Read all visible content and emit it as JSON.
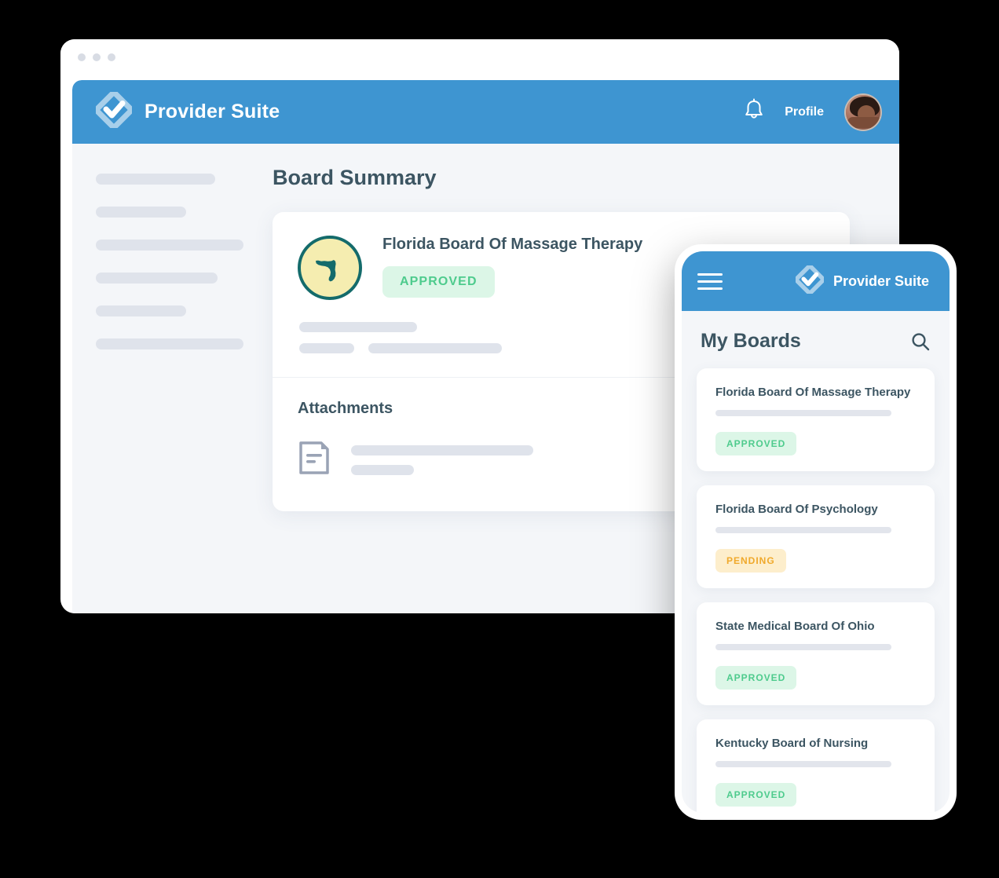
{
  "window": {
    "chrome_dots": [
      "dot-1",
      "dot-2",
      "dot-3"
    ]
  },
  "desktop": {
    "topbar": {
      "logo_icon": "diamond-check-logo-icon",
      "brand": "Provider Suite",
      "notification_icon": "bell-icon",
      "profile_label": "Profile",
      "avatar_icon": "user-avatar"
    },
    "sidebar": {
      "placeholder_widths": [
        152,
        115,
        188,
        155,
        115,
        188
      ]
    },
    "main": {
      "page_title": "Board Summary",
      "card": {
        "seal_icon": "florida-state-seal-icon",
        "board_name": "Florida Board Of Massage Therapy",
        "status": "APPROVED",
        "placeholder_rows": [
          [
            150
          ],
          [
            70,
            170
          ]
        ],
        "attachments_title": "Attachments",
        "attachment_icon": "document-icon",
        "attachment_placeholder_widths": [
          232,
          80
        ]
      }
    }
  },
  "phone": {
    "topbar": {
      "menu_icon": "hamburger-menu-icon",
      "logo_icon": "diamond-check-logo-icon",
      "brand": "Provider Suite"
    },
    "header": {
      "title": "My Boards",
      "search_icon": "search-icon"
    },
    "boards": [
      {
        "name": "Florida Board Of Massage Therapy",
        "status": "APPROVED",
        "status_type": "approved"
      },
      {
        "name": "Florida Board Of Psychology",
        "status": "PENDING",
        "status_type": "pending"
      },
      {
        "name": "State Medical Board Of Ohio",
        "status": "APPROVED",
        "status_type": "approved"
      },
      {
        "name": "Kentucky Board of Nursing",
        "status": "APPROVED",
        "status_type": "approved"
      }
    ]
  },
  "colors": {
    "brand_blue": "#3e95d1",
    "heading_slate": "#3c5562",
    "approved_bg": "#dcf6e7",
    "approved_text": "#4ecb8d",
    "pending_bg": "#fdeecc",
    "pending_text": "#f0a92b",
    "seal_ring": "#146b6b",
    "seal_fill": "#f5edb0",
    "skeleton": "#dfe3eb",
    "page_bg": "#f4f6f9"
  }
}
